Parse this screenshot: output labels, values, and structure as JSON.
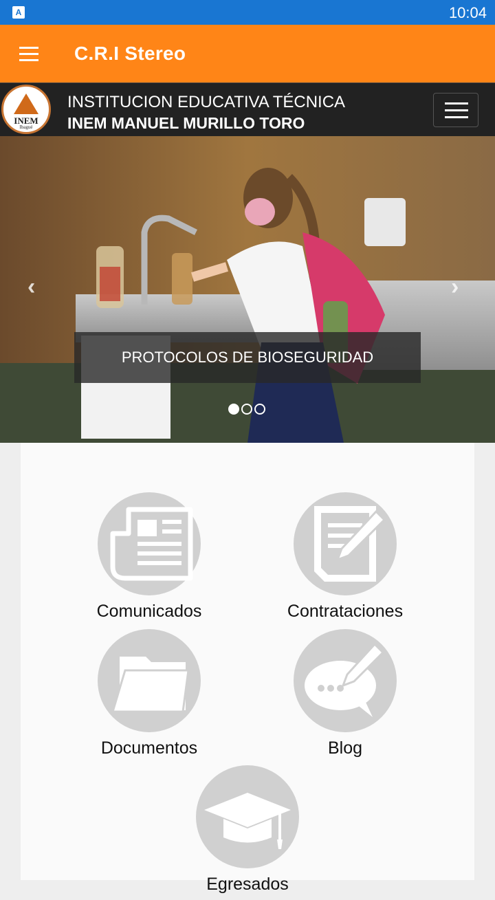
{
  "status_bar": {
    "time": "10:04",
    "app_icon_letter": "A"
  },
  "app_bar": {
    "title": "C.R.I Stereo",
    "menu_icon": "hamburger-icon"
  },
  "site_header": {
    "logo_text": "INEM",
    "logo_subtext": "Ibagué",
    "line1": "INSTITUCION EDUCATIVA TÉCNICA",
    "line2": "INEM MANUEL MURILLO TORO",
    "toggle_icon": "hamburger-icon"
  },
  "carousel": {
    "caption": "PROTOCOLOS DE BIOSEGURIDAD",
    "prev_icon": "‹",
    "next_icon": "›",
    "slide_count": 3,
    "active_slide": 1
  },
  "tiles": [
    {
      "label": "Comunicados",
      "icon": "newspaper-icon"
    },
    {
      "label": "Contrataciones",
      "icon": "document-edit-icon"
    },
    {
      "label": "Documentos",
      "icon": "folder-icon"
    },
    {
      "label": "Blog",
      "icon": "speech-bubble-pencil-icon"
    },
    {
      "label": "Egresados",
      "icon": "graduation-cap-icon"
    }
  ],
  "colors": {
    "status_bar": "#1976d2",
    "app_bar": "#ff8517",
    "icon_circle": "#d0d0d0"
  }
}
